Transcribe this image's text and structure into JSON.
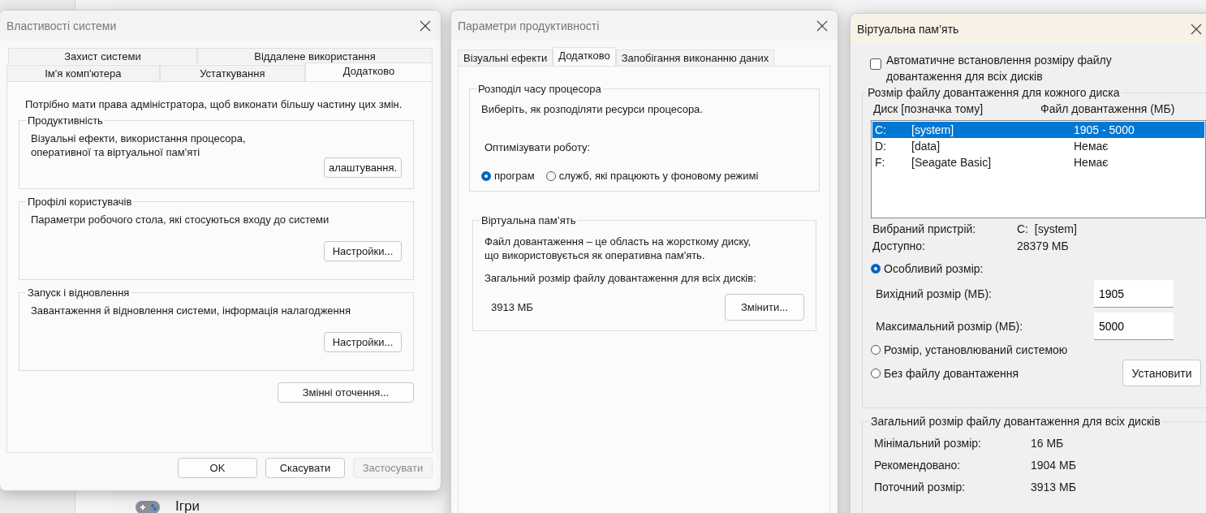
{
  "background": {
    "nav_item": "Ігри"
  },
  "system_properties": {
    "title": "Властивості системи",
    "tab_rows": [
      [
        {
          "label": "Захист системи",
          "selected": false
        },
        {
          "label": "Віддалене використання",
          "selected": false
        }
      ],
      [
        {
          "label": "Ім'я комп'ютера",
          "selected": false
        },
        {
          "label": "Устаткування",
          "selected": false
        },
        {
          "label": "Додатково",
          "selected": true
        }
      ]
    ],
    "admin_note": "Потрібно мати права адміністратора, щоб виконати більшу частину цих змін.",
    "groups": [
      {
        "title": "Продуктивність",
        "description": "Візуальні ефекти, використання процесора,\nоперативної та віртуальної пам'яті",
        "button": "алаштування."
      },
      {
        "title": "Профілі користувачів",
        "description": "Параметри робочого стола, які стосуються входу до системи",
        "button": "Настройки..."
      },
      {
        "title": "Запуск і відновлення",
        "description": "Завантаження й відновлення системи, інформація налагодження",
        "button": "Настройки..."
      }
    ],
    "env_button": "Змінні оточення...",
    "buttons": [
      {
        "label": "OK",
        "disabled": false
      },
      {
        "label": "Скасувати",
        "disabled": false
      },
      {
        "label": "Застосувати",
        "disabled": true
      }
    ]
  },
  "performance_options": {
    "title": "Параметри продуктивності",
    "tabs": [
      {
        "label": "Візуальні ефекти",
        "selected": false
      },
      {
        "label": "Додатково",
        "selected": true
      },
      {
        "label": "Запобігання виконанню даних",
        "selected": false
      }
    ],
    "cpu_group": {
      "title": "Розподіл часу процесора",
      "description": "Виберіть, як розподіляти ресурси процесора.",
      "optimize_label": "Оптимізувати роботу:",
      "options": [
        {
          "label": "програм",
          "selected": true
        },
        {
          "label": "служб, які працюють у фоновому режимі",
          "selected": false
        }
      ]
    },
    "vm_group": {
      "title": "Віртуальна пам’ять",
      "description": "Файл довантаження – це область на жорсткому диску,\nщо використовується як оперативна пам'ять.",
      "total_label": "Загальний розмір файлу довантаження для всіх дисків:",
      "total_value": "3913 МБ",
      "button": "Змінити..."
    }
  },
  "virtual_memory": {
    "title": "Віртуальна пам’ять",
    "auto_manage": {
      "label": "Автоматичне встановлення розміру файлу\nдовантаження для всіх дисків",
      "checked": false
    },
    "per_drive": {
      "title": "Розмір файлу довантаження для кожного диска",
      "columns": [
        "Диск [позначка тому]",
        "Файл довантаження (МБ)"
      ],
      "drives": [
        {
          "drive": "C:",
          "volume": "[system]",
          "size": "1905 - 5000",
          "selected": true
        },
        {
          "drive": "D:",
          "volume": "[data]",
          "size": "Немає",
          "selected": false
        },
        {
          "drive": "F:",
          "volume": "[Seagate Basic]",
          "size": "Немає",
          "selected": false
        }
      ],
      "info": [
        {
          "label": "Вибраний пристрій:",
          "value": "C:  [system]"
        },
        {
          "label": "Доступно:",
          "value": "28379 МБ"
        }
      ],
      "size_modes": [
        {
          "label": "Особливий розмір:",
          "selected": true,
          "fields": [
            {
              "label": "Вихідний розмір (МБ):",
              "value": "1905"
            },
            {
              "label": "Максимальний розмір (МБ):",
              "value": "5000"
            }
          ]
        },
        {
          "label": "Розмір, установлюваний системою",
          "selected": false
        },
        {
          "label": "Без файлу довантаження",
          "selected": false
        }
      ],
      "set_button": "Установити"
    },
    "totals": {
      "title": "Загальний розмір файлу довантаження для всіх дисків",
      "rows": [
        {
          "label": "Мінімальний розмір:",
          "value": "16 МБ"
        },
        {
          "label": "Рекомендовано:",
          "value": "1904 МБ"
        },
        {
          "label": "Поточний розмір:",
          "value": "3913 МБ"
        }
      ]
    }
  }
}
